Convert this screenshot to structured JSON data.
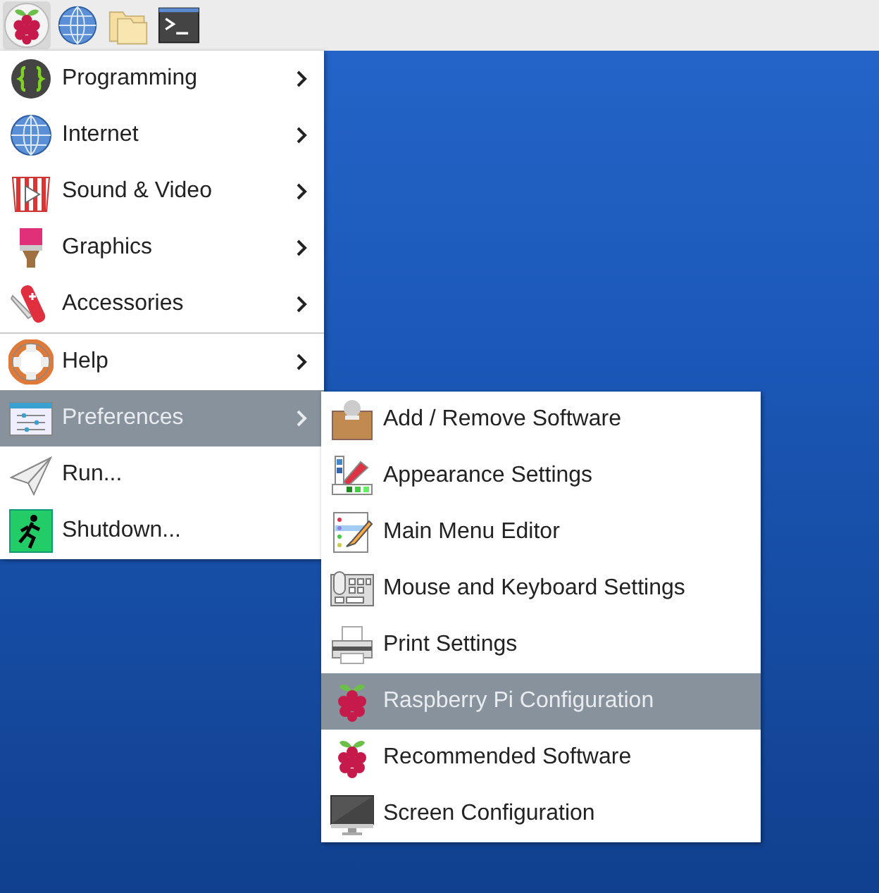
{
  "taskbar": {
    "launchers": [
      {
        "selected": true
      },
      {
        "selected": false
      },
      {
        "selected": false
      },
      {
        "selected": false
      }
    ]
  },
  "main_menu": {
    "groups": [
      [
        {
          "label": "Programming",
          "submenu": true,
          "selected": false
        },
        {
          "label": "Internet",
          "submenu": true,
          "selected": false
        },
        {
          "label": "Sound & Video",
          "submenu": true,
          "selected": false
        },
        {
          "label": "Graphics",
          "submenu": true,
          "selected": false
        },
        {
          "label": "Accessories",
          "submenu": true,
          "selected": false
        }
      ],
      [
        {
          "label": "Help",
          "submenu": true,
          "selected": false
        },
        {
          "label": "Preferences",
          "submenu": true,
          "selected": true
        },
        {
          "label": "Run...",
          "submenu": false,
          "selected": false
        },
        {
          "label": "Shutdown...",
          "submenu": false,
          "selected": false
        }
      ]
    ]
  },
  "submenu": {
    "items": [
      {
        "label": "Add / Remove Software",
        "selected": false
      },
      {
        "label": "Appearance Settings",
        "selected": false
      },
      {
        "label": "Main Menu Editor",
        "selected": false
      },
      {
        "label": "Mouse and Keyboard Settings",
        "selected": false
      },
      {
        "label": "Print Settings",
        "selected": false
      },
      {
        "label": "Raspberry Pi Configuration",
        "selected": true
      },
      {
        "label": "Recommended Software",
        "selected": false
      },
      {
        "label": "Screen Configuration",
        "selected": false
      }
    ]
  }
}
